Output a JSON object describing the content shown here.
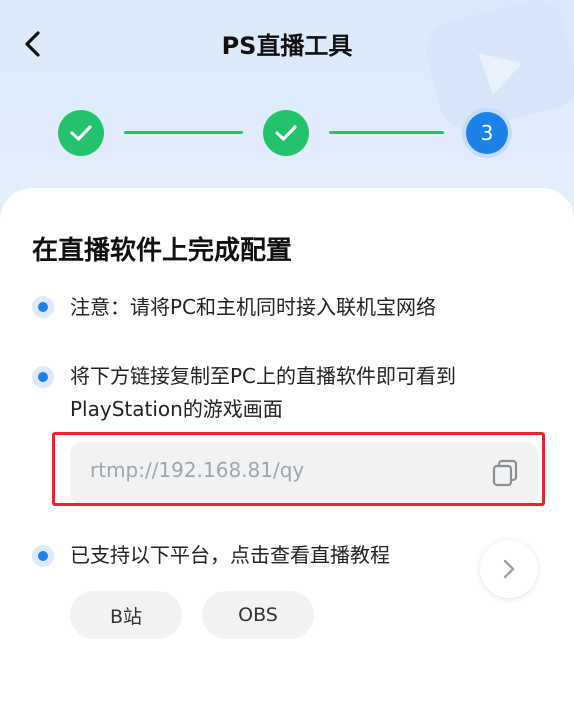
{
  "header": {
    "title": "PS直播工具"
  },
  "stepper": {
    "current_step": "3"
  },
  "card": {
    "title": "在直播软件上完成配置",
    "notice": "注意：请将PC和主机同时接入联机宝网络",
    "instruction_line1": "将下方链接复制至PC上的直播软件即可看到",
    "instruction_line2": "PlayStation的游戏画面",
    "url": "rtmp://192.168.81/qy",
    "platforms_text": "已支持以下平台，点击查看直播教程",
    "platforms": [
      "B站",
      "OBS"
    ]
  },
  "colors": {
    "accent": "#1b82ea",
    "success": "#23c36b",
    "highlight": "#e3272d"
  },
  "icons": {
    "back": "chevron-left-icon",
    "done": "check-icon",
    "copy": "copy-icon",
    "more": "chevron-right-icon"
  }
}
